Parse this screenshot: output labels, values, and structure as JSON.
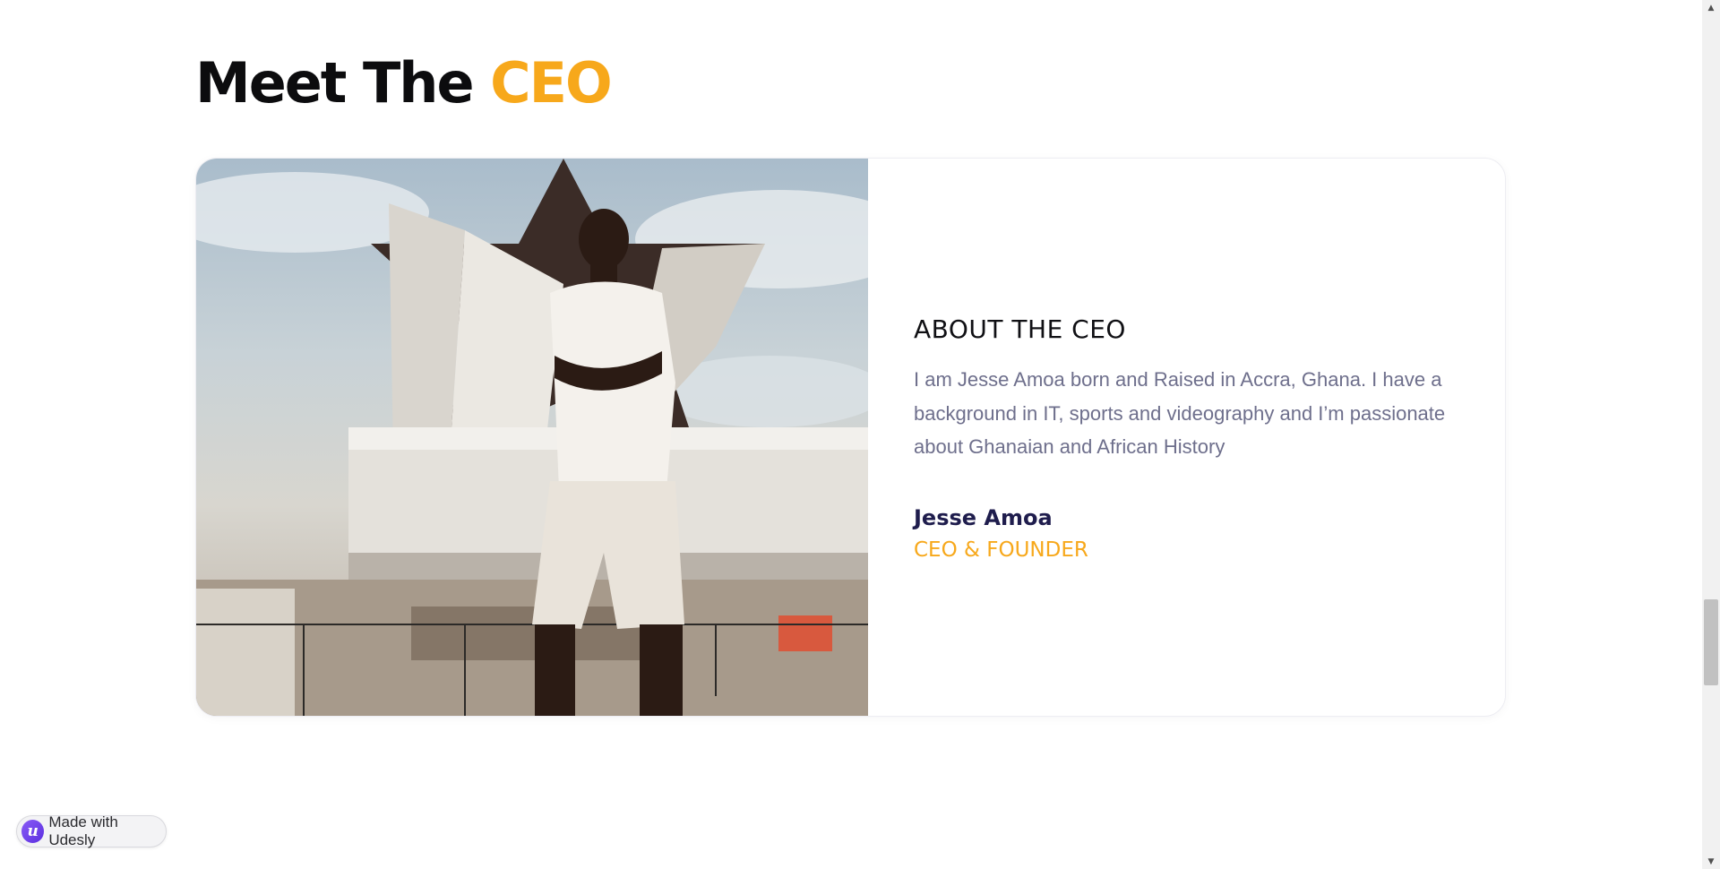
{
  "section": {
    "title_prefix": "Meet The",
    "title_accent": "CEO"
  },
  "card": {
    "photo": {
      "alt": "Jesse Amoa standing in front of Black Star monument"
    },
    "about_title": "ABOUT THE CEO",
    "about_text": "I am Jesse Amoa born and Raised in Accra, Ghana. I have a background in IT, sports and videography and I’m passionate about Ghanaian and African History",
    "name": "Jesse Amoa",
    "role": "CEO & FOUNDER"
  },
  "badge": {
    "logo_letter": "u",
    "label": "Made with Udesly"
  },
  "scrollbar": {
    "up_icon": "▲",
    "down_icon": "▼"
  },
  "colors": {
    "accent": "#f7a81b",
    "heading": "#0c0c0e",
    "body_text": "#6e6f8c",
    "name": "#1f1d4d"
  }
}
